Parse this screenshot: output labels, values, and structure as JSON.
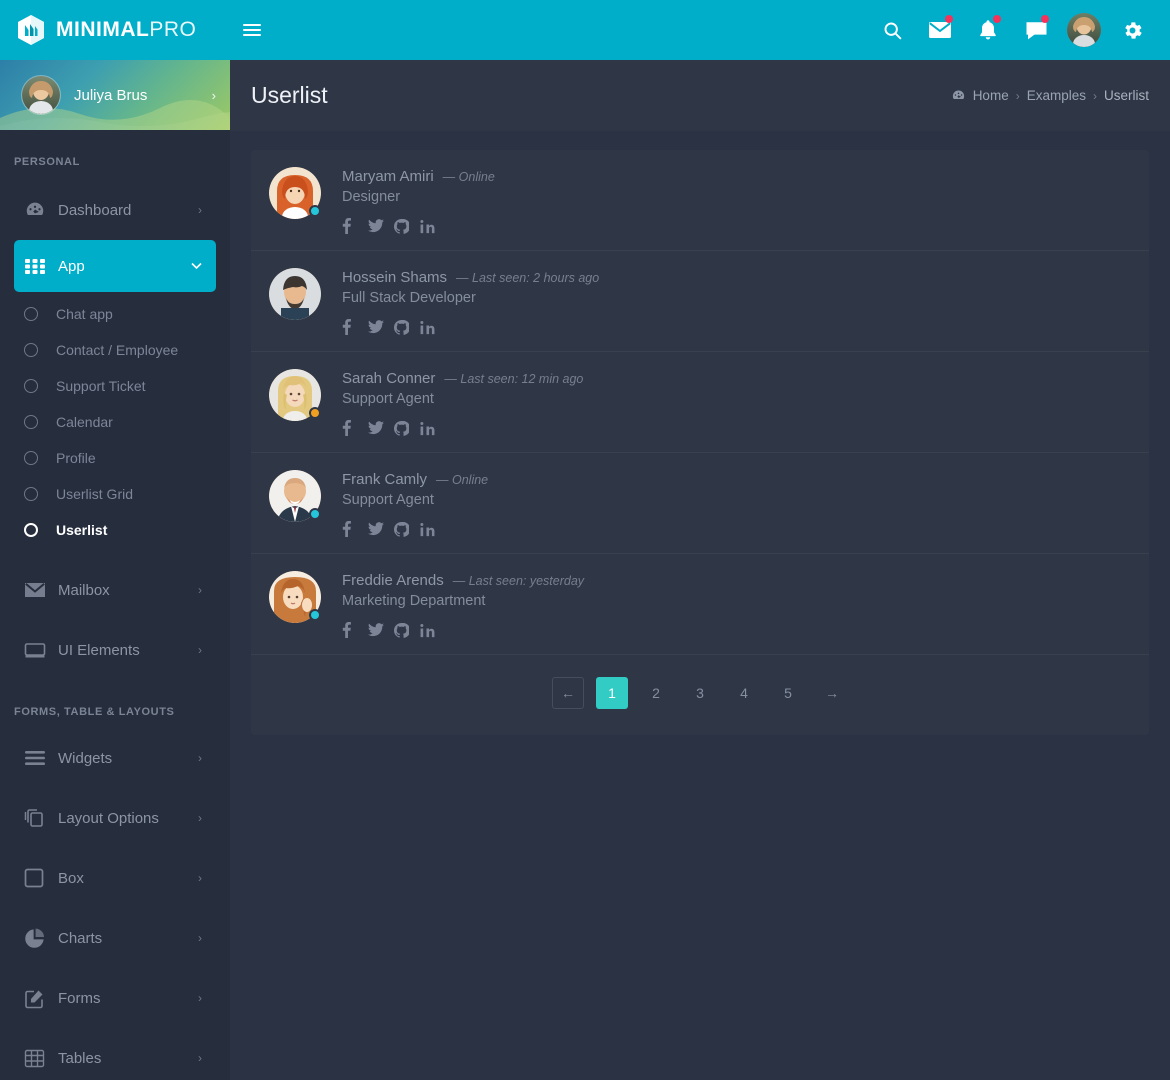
{
  "brand": {
    "bold": "MINIMAL",
    "light": "PRO",
    "logo_icon": "hexagon-m-logo"
  },
  "topbar": {
    "menu_toggle_icon": "hamburger-icon",
    "icons": [
      {
        "name": "search-icon",
        "badge": false
      },
      {
        "name": "mail-icon",
        "badge": true
      },
      {
        "name": "bell-icon",
        "badge": true
      },
      {
        "name": "chat-icon",
        "badge": true
      }
    ],
    "avatar_name": "user-avatar",
    "settings_icon": "gear-icon"
  },
  "sidebar": {
    "profile": {
      "name": "Juliya Brus",
      "caret": "›",
      "avatar": "profile-avatar"
    },
    "sections": [
      {
        "label": "PERSONAL",
        "items": [
          {
            "label": "Dashboard",
            "icon": "dashboard-icon",
            "caret": "›",
            "active": false
          },
          {
            "label": "App",
            "icon": "grid-icon",
            "caret": "⌄",
            "active": true
          },
          {
            "label": "Mailbox",
            "icon": "mail-icon",
            "caret": "›",
            "active": false
          },
          {
            "label": "UI Elements",
            "icon": "window-icon",
            "caret": "›",
            "active": false
          }
        ]
      },
      {
        "label": "FORMS, TABLE & LAYOUTS",
        "items": [
          {
            "label": "Widgets",
            "icon": "list-icon",
            "caret": "›",
            "active": false
          },
          {
            "label": "Layout Options",
            "icon": "layers-icon",
            "caret": "›",
            "active": false
          },
          {
            "label": "Box",
            "icon": "square-icon",
            "caret": "›",
            "active": false
          },
          {
            "label": "Charts",
            "icon": "pie-chart-icon",
            "caret": "›",
            "active": false
          },
          {
            "label": "Forms",
            "icon": "edit-icon",
            "caret": "›",
            "active": false
          },
          {
            "label": "Tables",
            "icon": "table-icon",
            "caret": "›",
            "active": false
          }
        ]
      }
    ],
    "app_subitems": [
      {
        "label": "Chat app",
        "active": false
      },
      {
        "label": "Contact / Employee",
        "active": false
      },
      {
        "label": "Support Ticket",
        "active": false
      },
      {
        "label": "Calendar",
        "active": false
      },
      {
        "label": "Profile",
        "active": false
      },
      {
        "label": "Userlist Grid",
        "active": false
      },
      {
        "label": "Userlist",
        "active": true
      }
    ]
  },
  "page": {
    "title": "Userlist",
    "breadcrumb": {
      "home_icon": "dashboard-home-icon",
      "items": [
        "Home",
        "Examples",
        "Userlist"
      ],
      "separator": "›"
    }
  },
  "colors": {
    "brand_cyan": "#00aec9",
    "accent_teal": "#33ccc4",
    "badge_red": "#f5325c",
    "status_online": "#26c6da",
    "status_away": "#f0a020",
    "sidebar_bg": "#262d3d",
    "page_bg": "#2b3243",
    "card_bg": "#2f3747"
  },
  "users": [
    {
      "name": "Maryam Amiri",
      "status_text": "— Online",
      "role": "Designer",
      "status_color": "#26c6da",
      "avatar": "avatar-maryam-amiri",
      "socials": [
        "facebook-icon",
        "twitter-icon",
        "github-icon",
        "linkedin-icon"
      ]
    },
    {
      "name": "Hossein Shams",
      "status_text": "— Last seen: 2 hours ago",
      "role": "Full Stack Developer",
      "status_color": "",
      "avatar": "avatar-hossein-shams",
      "socials": [
        "facebook-icon",
        "twitter-icon",
        "github-icon",
        "linkedin-icon"
      ]
    },
    {
      "name": "Sarah Conner",
      "status_text": "— Last seen: 12 min ago",
      "role": "Support Agent",
      "status_color": "#f0a020",
      "avatar": "avatar-sarah-conner",
      "socials": [
        "facebook-icon",
        "twitter-icon",
        "github-icon",
        "linkedin-icon"
      ]
    },
    {
      "name": "Frank Camly",
      "status_text": "— Online",
      "role": "Support Agent",
      "status_color": "#26c6da",
      "avatar": "avatar-frank-camly",
      "socials": [
        "facebook-icon",
        "twitter-icon",
        "github-icon",
        "linkedin-icon"
      ]
    },
    {
      "name": "Freddie Arends",
      "status_text": "— Last seen: yesterday",
      "role": "Marketing Department",
      "status_color": "#26c6da",
      "avatar": "avatar-freddie-arends",
      "socials": [
        "facebook-icon",
        "twitter-icon",
        "github-icon",
        "linkedin-icon"
      ]
    }
  ],
  "pagination": {
    "prev": "←",
    "next": "→",
    "pages": [
      "1",
      "2",
      "3",
      "4",
      "5"
    ],
    "active": "1"
  }
}
